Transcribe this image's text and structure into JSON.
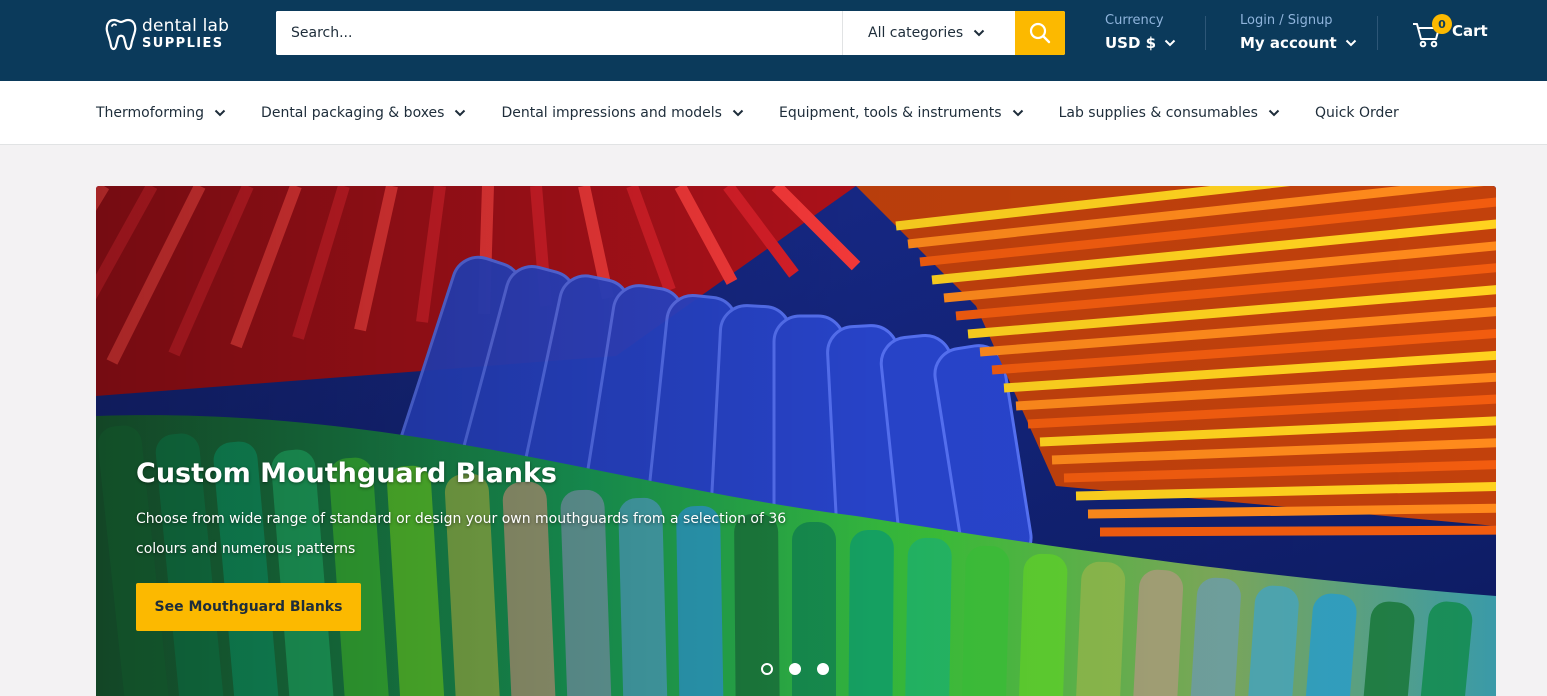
{
  "logo": {
    "line1": "dental lab",
    "line2": "SUPPLIES"
  },
  "search": {
    "placeholder": "Search...",
    "category": "All categories"
  },
  "currency": {
    "label": "Currency",
    "value": "USD $"
  },
  "account": {
    "label": "Login / Signup",
    "value": "My account"
  },
  "cart": {
    "count": "0",
    "label": "Cart"
  },
  "nav": {
    "items": [
      {
        "label": "Thermoforming"
      },
      {
        "label": "Dental packaging & boxes"
      },
      {
        "label": "Dental impressions and models"
      },
      {
        "label": "Equipment, tools & instruments"
      },
      {
        "label": "Lab supplies & consumables"
      },
      {
        "label": "Quick Order"
      }
    ]
  },
  "hero": {
    "title": "Custom Mouthguard Blanks",
    "text": "Choose from wide range of standard or design your own mouthguards from a selection of 36 colours and numerous patterns",
    "button": "See Mouthguard Blanks",
    "active_slide": 1,
    "slide_count": 3
  },
  "colors": {
    "header": "#0b3a5b",
    "accent": "#fcb900",
    "nav_bg": "#ffffff",
    "page_bg": "#f3f2f3"
  }
}
